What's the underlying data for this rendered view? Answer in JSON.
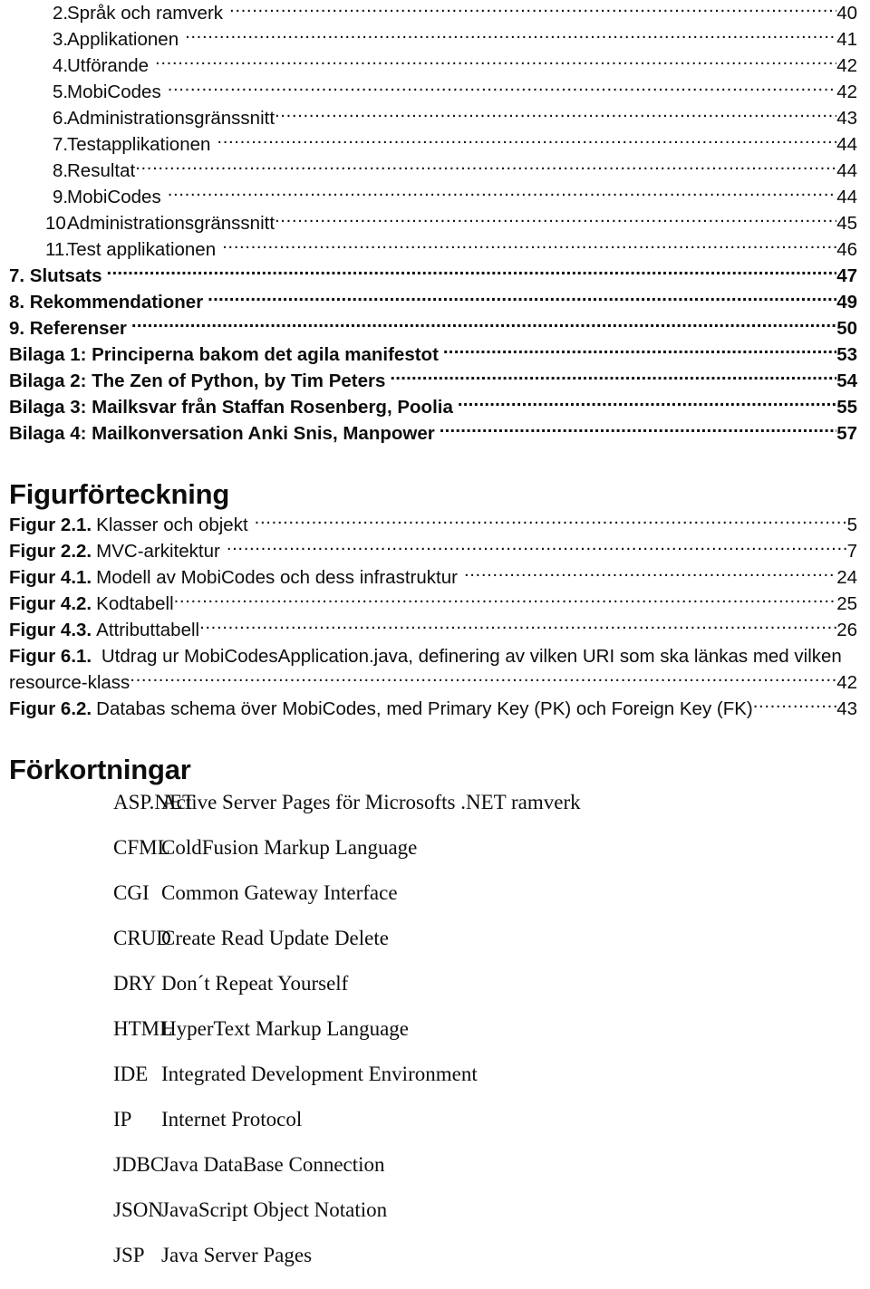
{
  "toc": {
    "numbered_items": [
      {
        "num": "2.",
        "label": "Språk och ramverk",
        "page": "40",
        "space_before_dots": true
      },
      {
        "num": "3.",
        "label": "Applikationen",
        "page": "41",
        "space_before_dots": true
      },
      {
        "num": "4.",
        "label": "Utförande",
        "page": "42",
        "space_before_dots": true
      },
      {
        "num": "5.",
        "label": "MobiCodes",
        "page": "42",
        "space_before_dots": true
      },
      {
        "num": "6.",
        "label": "Administrationsgränssnitt",
        "page": "43",
        "space_before_dots": false
      },
      {
        "num": "7.",
        "label": "Testapplikationen",
        "page": "44",
        "space_before_dots": true
      },
      {
        "num": "8.",
        "label": "Resultat",
        "page": "44",
        "space_before_dots": false
      },
      {
        "num": "9.",
        "label": "MobiCodes",
        "page": "44",
        "space_before_dots": true
      },
      {
        "num": "10.",
        "label": "Administrationsgränssnitt",
        "page": "45",
        "space_before_dots": false
      },
      {
        "num": "11.",
        "label": "Test applikationen",
        "page": "46",
        "space_before_dots": true
      }
    ],
    "main_items": [
      {
        "label": "7. Slutsats",
        "page": "47"
      },
      {
        "label": "8. Rekommendationer",
        "page": "49"
      },
      {
        "label": "9. Referenser",
        "page": "50"
      },
      {
        "label": "Bilaga 1: Principerna bakom det agila manifestot",
        "page": "53"
      },
      {
        "label": "Bilaga 2: The Zen of Python, by Tim Peters",
        "page": "54"
      },
      {
        "label": "Bilaga 3: Mailksvar från Staffan Rosenberg, Poolia",
        "page": "55"
      },
      {
        "label": "Bilaga 4: Mailkonversation Anki Snis, Manpower",
        "page": "57"
      }
    ]
  },
  "figure_list": {
    "heading": "Figurförteckning",
    "items": [
      {
        "key": "Figur 2.1.",
        "label": "Klasser och objekt",
        "page": "5",
        "space_before_dots": true
      },
      {
        "key": "Figur 2.2.",
        "label": "MVC-arkitektur",
        "page": "7",
        "space_before_dots": true
      },
      {
        "key": "Figur 4.1.",
        "label": "Modell av MobiCodes och dess infrastruktur",
        "page": "24",
        "space_before_dots": true
      },
      {
        "key": "Figur 4.2.",
        "label": "Kodtabell",
        "page": "25",
        "space_before_dots": false
      },
      {
        "key": "Figur 4.3.",
        "label": "Attributtabell",
        "page": "26",
        "space_before_dots": false
      }
    ],
    "wrapped_item": {
      "key": "Figur 6.1.",
      "line1": "Utdrag ur MobiCodesApplication.java, definering av vilken URI som ska länkas med vilken",
      "line2": "resource-klass",
      "page": "42"
    },
    "last_item": {
      "key": "Figur 6.2.",
      "label": "Databas schema över MobiCodes, med Primary Key (PK) och Foreign Key (FK)",
      "page": "43"
    }
  },
  "abbreviations": {
    "heading": "Förkortningar",
    "rows": [
      {
        "term": "ASP.NET",
        "desc": "Active Server Pages för Microsofts .NET ramverk"
      },
      {
        "term": "CFML",
        "desc": "ColdFusion Markup Language"
      },
      {
        "term": "CGI",
        "desc": "Common Gateway Interface"
      },
      {
        "term": "CRUD",
        "desc": "Create Read Update Delete"
      },
      {
        "term": "DRY",
        "desc": "Don´t Repeat Yourself"
      },
      {
        "term": "HTML",
        "desc": "HyperText Markup Language"
      },
      {
        "term": "IDE",
        "desc": "Integrated Development Environment"
      },
      {
        "term": "IP",
        "desc": "Internet Protocol"
      },
      {
        "term": "JDBC",
        "desc": "Java DataBase Connection"
      },
      {
        "term": "JSON",
        "desc": "JavaScript Object Notation"
      },
      {
        "term": "JSP",
        "desc": "Java Server Pages"
      }
    ]
  }
}
